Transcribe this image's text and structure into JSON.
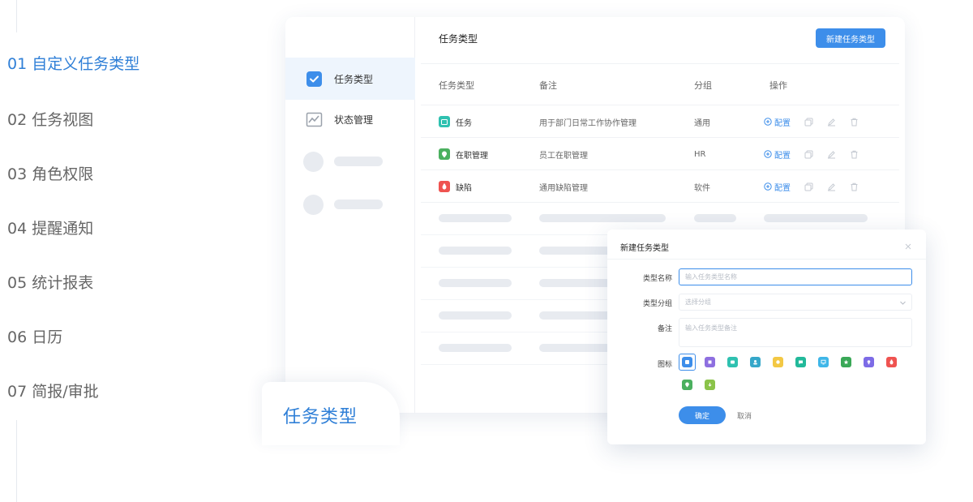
{
  "feature_nav": {
    "items": [
      {
        "label": "01 自定义任务类型",
        "active": true
      },
      {
        "label": "02 任务视图",
        "active": false
      },
      {
        "label": "03 角色权限",
        "active": false
      },
      {
        "label": "04 提醒通知",
        "active": false
      },
      {
        "label": "05 统计报表",
        "active": false
      },
      {
        "label": "06 日历",
        "active": false
      },
      {
        "label": "07 简报/审批",
        "active": false
      }
    ]
  },
  "sidebar": {
    "items": [
      {
        "label": "任务类型",
        "icon": "checkbox-icon",
        "active": true
      },
      {
        "label": "状态管理",
        "icon": "chart-icon",
        "active": false
      }
    ]
  },
  "main": {
    "title": "任务类型",
    "new_button": "新建任务类型",
    "columns": [
      "任务类型",
      "备注",
      "分组",
      "操作"
    ],
    "rows": [
      {
        "type": "任务",
        "icon_color": "#2fc1b0",
        "note": "用于部门日常工作协作管理",
        "group": "通用",
        "config": "配置"
      },
      {
        "type": "在职管理",
        "icon_color": "#4bb05f",
        "note": "员工在职管理",
        "group": "HR",
        "config": "配置"
      },
      {
        "type": "缺陷",
        "icon_color": "#ef5350",
        "note": "通用缺陷管理",
        "group": "软件",
        "config": "配置"
      }
    ]
  },
  "overlay_tab": {
    "label": "任务类型"
  },
  "dialog": {
    "title": "新建任务类型",
    "name_label": "类型名称",
    "name_placeholder": "输入任务类型名称",
    "group_label": "类型分组",
    "group_placeholder": "选择分组",
    "note_label": "备注",
    "note_placeholder": "输入任务类型备注",
    "icon_label": "图标",
    "icon_colors": [
      "#3d8eea",
      "#8e6fe0",
      "#2fc1b0",
      "#35a7c9",
      "#f3c844",
      "#22b99a",
      "#3fb6e8",
      "#3aa857",
      "#7d6be6",
      "#ef5350",
      "#4bb05f",
      "#8bc34a"
    ],
    "ok": "确定",
    "cancel": "取消"
  },
  "colors": {
    "accent": "#3d8eea",
    "nav_active": "#2f7fd7"
  }
}
